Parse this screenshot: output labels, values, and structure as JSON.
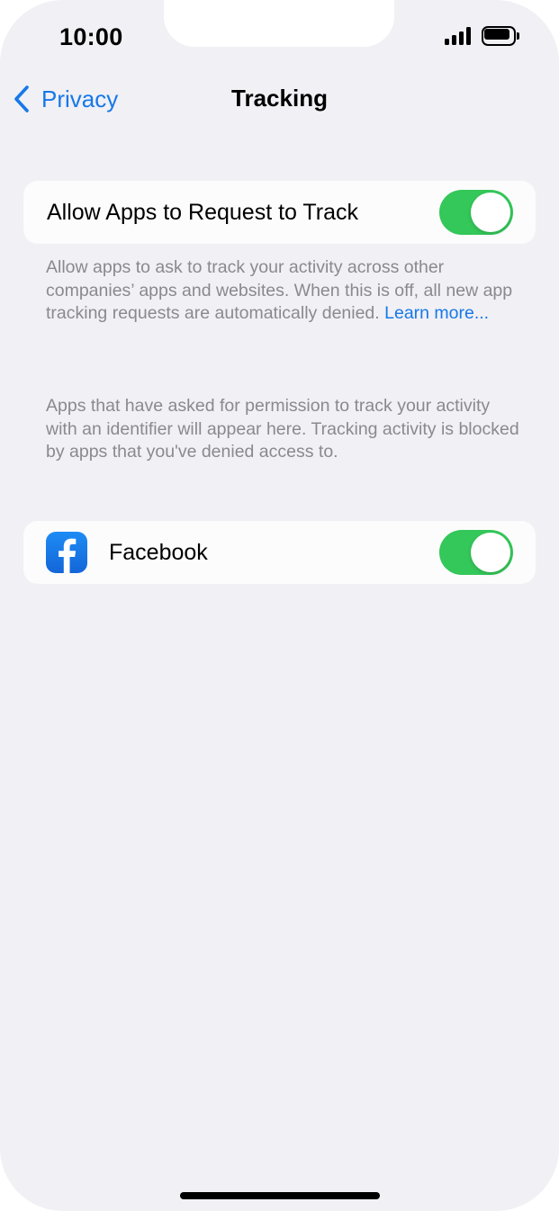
{
  "status_bar": {
    "time": "10:00",
    "signal_icon": "cellular-signal-icon",
    "battery_icon": "battery-icon"
  },
  "nav": {
    "back_label": "Privacy",
    "back_icon": "chevron-left-icon",
    "title": "Tracking"
  },
  "allow_tracking": {
    "label": "Allow Apps to Request to Track",
    "enabled": true,
    "footnote": "Allow apps to ask to track your activity across other companies’ apps and websites. When this is off, all new app tracking requests are automatically denied.",
    "learn_more": "Learn more..."
  },
  "apps_info": "Apps that have asked for permission to track your activity with an identifier will appear here. Tracking activity is blocked by apps that you've denied access to.",
  "apps": [
    {
      "name": "Facebook",
      "icon": "facebook-icon",
      "enabled": true
    }
  ],
  "colors": {
    "accent": "#1778e8",
    "toggle_on": "#34c759",
    "background": "#f0f0f5",
    "footnote": "#8a8a8e"
  }
}
